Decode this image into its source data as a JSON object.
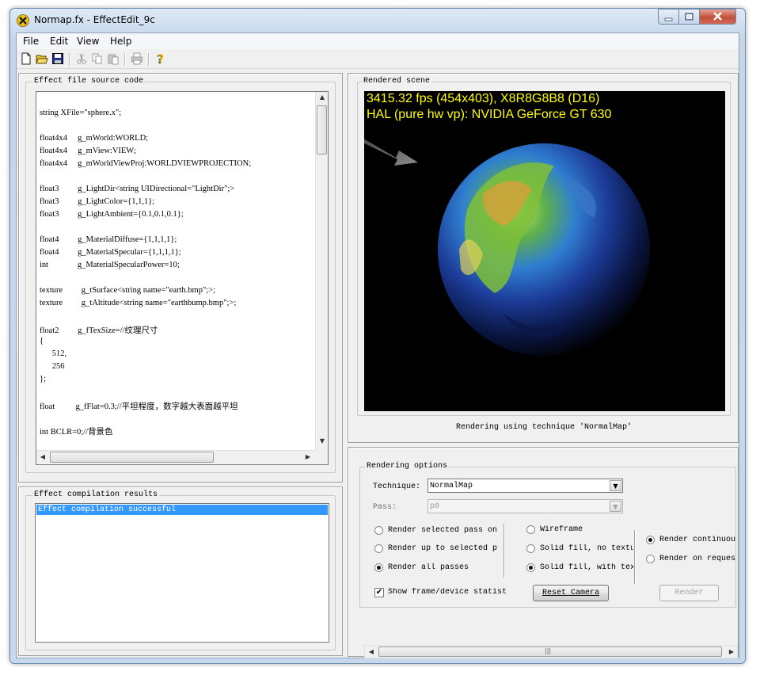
{
  "window": {
    "title": "Normap.fx - EffectEdit_9c"
  },
  "menu": [
    "File",
    "Edit",
    "View",
    "Help"
  ],
  "toolbar": [
    "new-icon",
    "open-icon",
    "save-icon",
    "cut-icon",
    "copy-icon",
    "paste-icon",
    "print-icon",
    "help-icon"
  ],
  "source": {
    "label": "Effect file source code",
    "lines": [
      "string XFile=\"sphere.x\";",
      "float4x4     g_mWorld:WORLD;",
      "float4x4     g_mView:VIEW;",
      "float4x4     g_mWorldViewProj:WORLDVIEWPROJECTION;",
      "float3         g_LightDir<string UIDirectional=\"LightDir\";>",
      "float3         g_LightColor={1,1,1};",
      "float3         g_LightAmbient={0.1,0.1,0.1};",
      "float4         g_MaterialDiffuse={1,1,1,1};",
      "float4         g_MaterialSpecular={1,1,1,1};",
      "int              g_MaterialSpecularPower=10;",
      "texture         g_tSurface<string name=\"earth.bmp\";>;",
      "texture         g_tAltitude<string name=\"earthbump.bmp\";>;",
      "float2         g_fTexSize=//纹理尺寸",
      "{",
      "      512,",
      "      256",
      "};",
      "float          g_fFlat=0.3;//平坦程度，数字越大表面越平坦",
      "int BCLR=0;//背景色"
    ]
  },
  "results": {
    "label": "Effect compilation results",
    "items": [
      "Effect compilation successful"
    ]
  },
  "scene": {
    "label": "Rendered scene",
    "hud_line1": "3415.32 fps (454x403), X8R8G8B8 (D16)",
    "hud_line2": "HAL (pure hw vp): NVIDIA GeForce GT 630",
    "status": "Rendering using technique 'NormalMap'"
  },
  "options": {
    "label": "Rendering options",
    "technique_label": "Technique:",
    "technique_value": "NormalMap",
    "pass_label": "Pass:",
    "pass_value": "p0",
    "render_selected": "Render selected pass on",
    "render_upto": "Render up to selected p",
    "render_all": "Render all passes",
    "show_stats": "Show frame/device statist",
    "wireframe": "Wireframe",
    "solid_no_tex": "Solid fill, no textu",
    "solid_tex": "Solid fill, with tex",
    "render_cont": "Render continuou",
    "render_request": "Render on reques",
    "reset_camera": "Reset Camera",
    "render_button": "Render",
    "pass_mode_selected": "render_all",
    "fill_mode_selected": "solid_tex",
    "update_mode_selected": "render_cont",
    "show_stats_checked": true
  }
}
